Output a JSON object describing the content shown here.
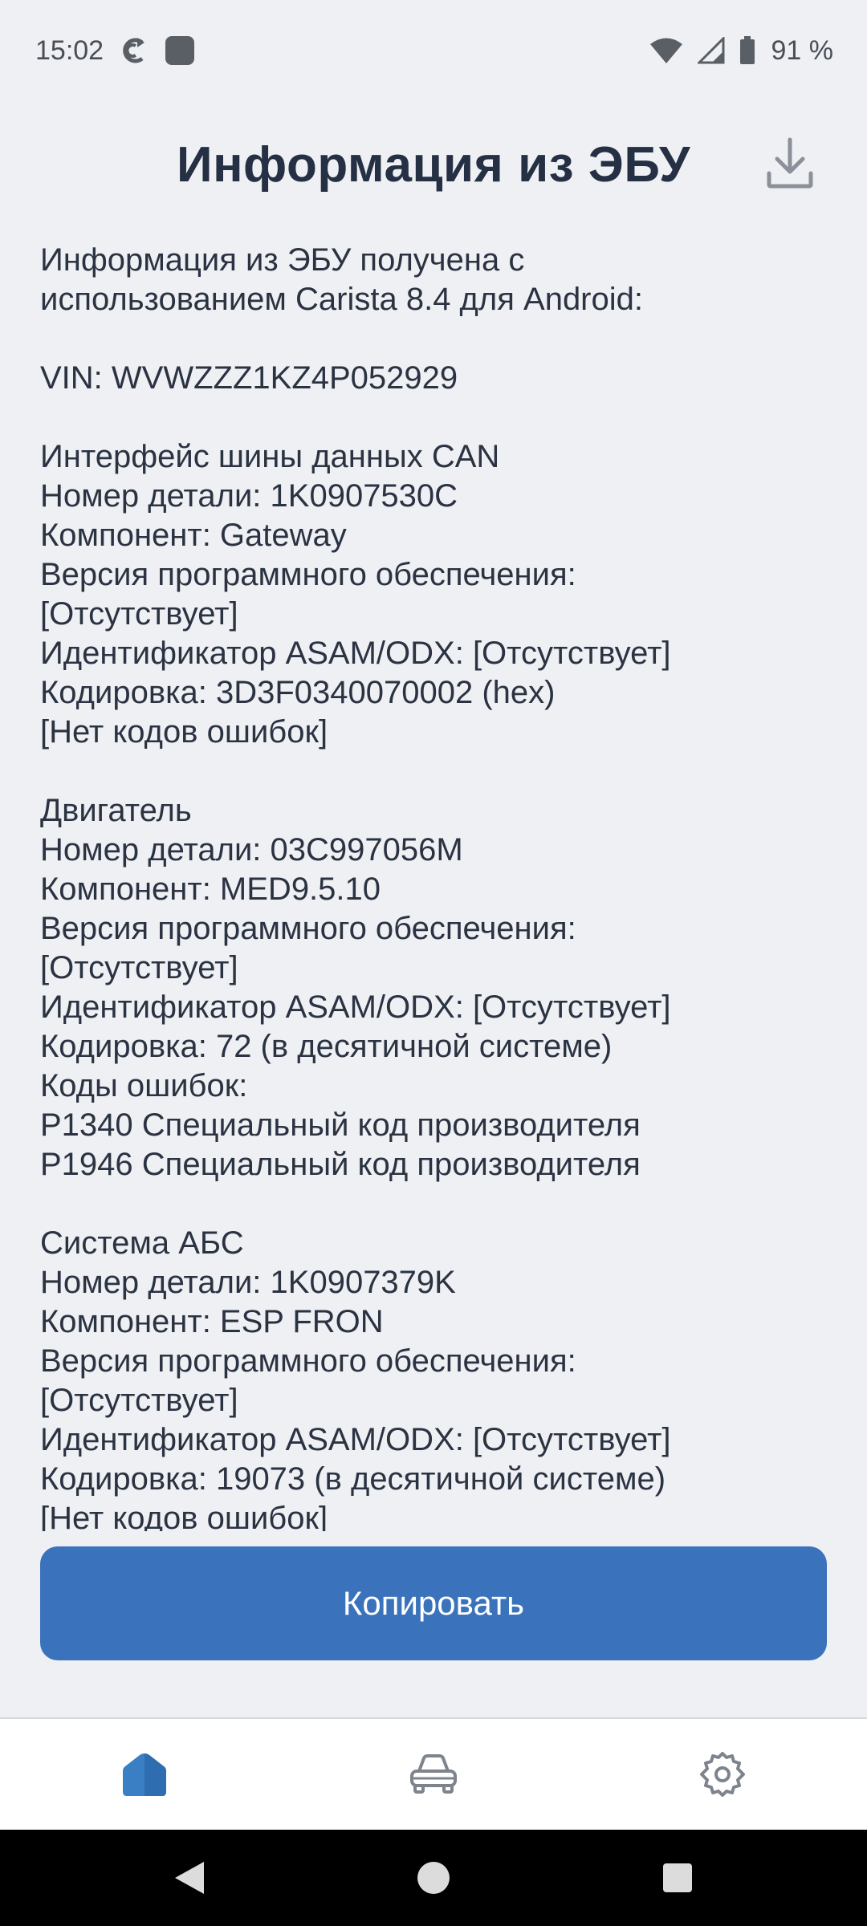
{
  "status_bar": {
    "time": "15:02",
    "battery": "91 %",
    "icons": [
      "sync-icon",
      "app-square-icon",
      "wifi-icon",
      "signal-icon",
      "battery-icon"
    ]
  },
  "header": {
    "title": "Информация из ЭБУ",
    "download_icon": "download-icon"
  },
  "content": {
    "text": "Информация из ЭБУ получена с\nиспользованием Carista 8.4 для Android:\n\nVIN: WVWZZZ1KZ4P052929\n\nИнтерфейс шины данных CAN\nНомер детали: 1K0907530C\nКомпонент: Gateway\nВерсия программного обеспечения:\n[Отсутствует]\nИдентификатор ASAM/ODX: [Отсутствует]\nКодировка: 3D3F0340070002 (hex)\n[Нет кодов ошибок]\n\nДвигатель\nНомер детали: 03C997056M\nКомпонент: MED9.5.10\nВерсия программного обеспечения:\n[Отсутствует]\nИдентификатор ASAM/ODX: [Отсутствует]\nКодировка: 72 (в десятичной системе)\nКоды ошибок:\nP1340 Специальный код производителя\nP1946 Специальный код производителя\n\nСистема АБС\nНомер детали: 1K0907379K\nКомпонент: ESP FRON\nВерсия программного обеспечения:\n[Отсутствует]\nИдентификатор ASAM/ODX: [Отсутствует]\nКодировка: 19073 (в десятичной системе)\n[Нет кодов ошибок]"
  },
  "actions": {
    "copy_label": "Копировать"
  },
  "bottom_nav": {
    "items": [
      "home-icon",
      "car-icon",
      "settings-icon"
    ],
    "active_color": "#3a7fc4"
  },
  "system_nav": [
    "back-icon",
    "home-circle-icon",
    "recents-icon"
  ],
  "colors": {
    "accent": "#3a72bb",
    "background": "#eef0f4"
  }
}
